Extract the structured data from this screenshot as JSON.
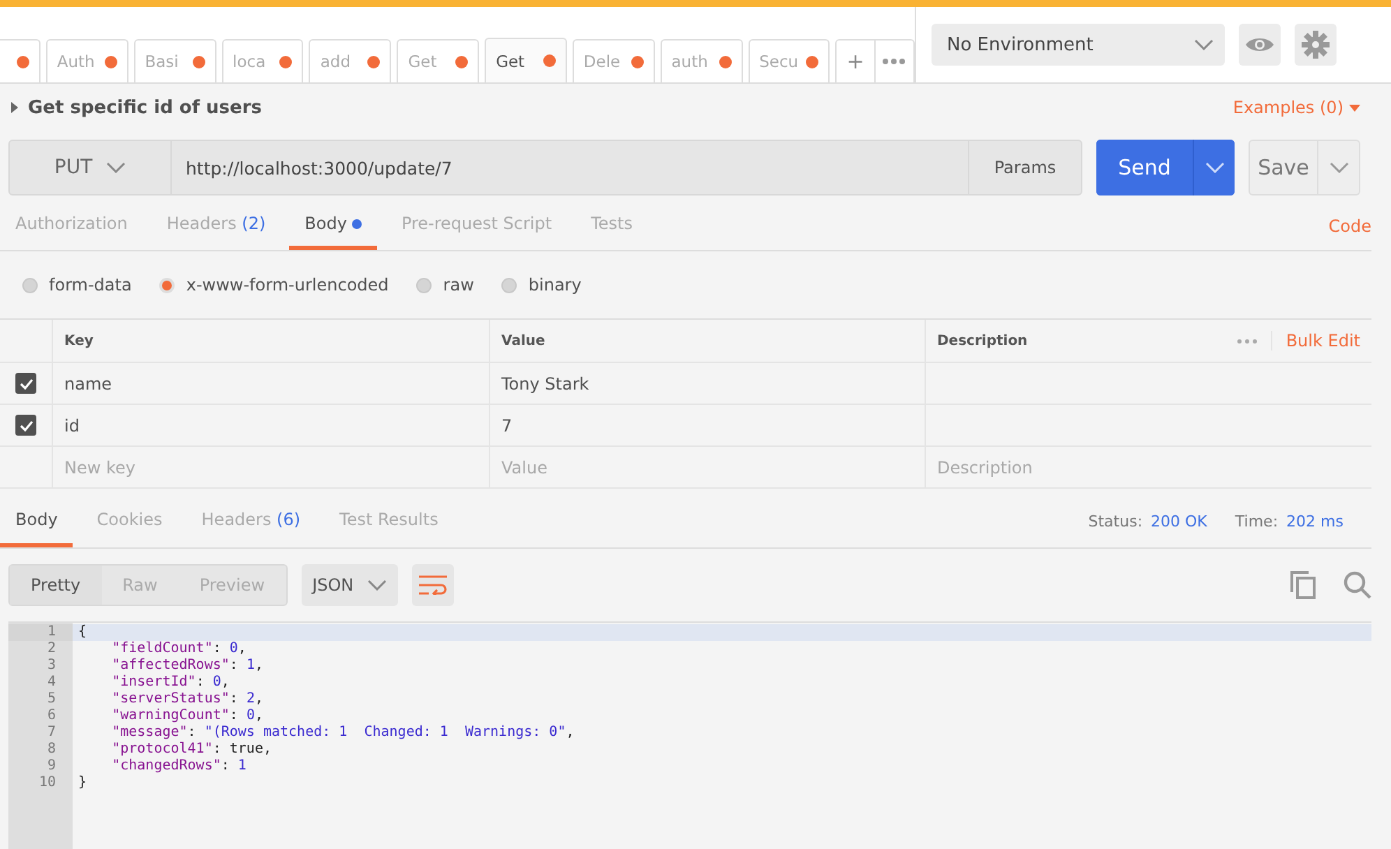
{
  "tabs": [
    {
      "selected": false,
      "unsaved": true
    },
    {
      "label": "Auth",
      "selected": false,
      "unsaved": true
    },
    {
      "label": "Basi",
      "selected": false,
      "unsaved": true
    },
    {
      "label": "loca",
      "selected": false,
      "unsaved": true
    },
    {
      "label": "add",
      "selected": false,
      "unsaved": true
    },
    {
      "label": "Get",
      "selected": false,
      "unsaved": true
    },
    {
      "label": "Get",
      "selected": true,
      "unsaved": true
    },
    {
      "label": "Dele",
      "selected": false,
      "unsaved": true
    },
    {
      "label": "auth",
      "selected": false,
      "unsaved": true
    },
    {
      "label": "Secu",
      "selected": false,
      "unsaved": true
    }
  ],
  "new_tab": "+",
  "environment": {
    "value": "No Environment"
  },
  "request": {
    "name": "Get specific id of users",
    "examples": "Examples (0)",
    "method": "PUT",
    "url": "http://localhost:3000/update/7",
    "params": "Params",
    "send": "Send",
    "save": "Save"
  },
  "request_tabs": [
    {
      "label": "Authorization",
      "selected": false,
      "dot": false
    },
    {
      "label": "Headers",
      "count": "(2)",
      "selected": false,
      "dot": false
    },
    {
      "label": "Body",
      "selected": true,
      "dot": true
    },
    {
      "label": "Pre-request Script",
      "selected": false,
      "dot": false
    },
    {
      "label": "Tests",
      "selected": false,
      "dot": false
    }
  ],
  "code_link": "Code",
  "body_types": [
    {
      "label": "form-data",
      "selected": false
    },
    {
      "label": "x-www-form-urlencoded",
      "selected": true
    },
    {
      "label": "raw",
      "selected": false
    },
    {
      "label": "binary",
      "selected": false
    }
  ],
  "params_table": {
    "columns": [
      "Key",
      "Value",
      "Description"
    ],
    "bulk_edit": "Bulk Edit",
    "rows": [
      {
        "key": "name",
        "value": "Tony Stark",
        "checked": true
      },
      {
        "key": "id",
        "value": "7",
        "checked": true
      }
    ],
    "new_row": {
      "key_placeholder": "New key",
      "value_placeholder": "Value",
      "description_placeholder": "Description"
    }
  },
  "response_tabs": [
    {
      "label": "Body",
      "selected": true
    },
    {
      "label": "Cookies",
      "selected": false
    },
    {
      "label": "Headers",
      "count": "(6)",
      "selected": false
    },
    {
      "label": "Test Results",
      "selected": false
    }
  ],
  "status": {
    "label": "Status:",
    "value": "200 OK"
  },
  "time": {
    "label": "Time:",
    "value": "202 ms"
  },
  "view_modes": [
    {
      "label": "Pretty",
      "selected": true
    },
    {
      "label": "Raw",
      "selected": false
    },
    {
      "label": "Preview",
      "selected": false
    }
  ],
  "format": "JSON",
  "code_lines": [
    {
      "number": "1",
      "text": "{"
    },
    {
      "number": "2",
      "text": "    \"fieldCount\": 0,"
    },
    {
      "number": "3",
      "text": "    \"affectedRows\": 1,"
    },
    {
      "number": "4",
      "text": "    \"insertId\": 0,"
    },
    {
      "number": "5",
      "text": "    \"serverStatus\": 2,"
    },
    {
      "number": "6",
      "text": "    \"warningCount\": 0,"
    },
    {
      "number": "7",
      "text": "    \"message\": \"(Rows matched: 1  Changed: 1  Warnings: 0\","
    },
    {
      "number": "8",
      "text": "    \"protocol41\": true,"
    },
    {
      "number": "9",
      "text": "    \"changedRows\": 1"
    },
    {
      "number": "10",
      "text": "}"
    }
  ]
}
